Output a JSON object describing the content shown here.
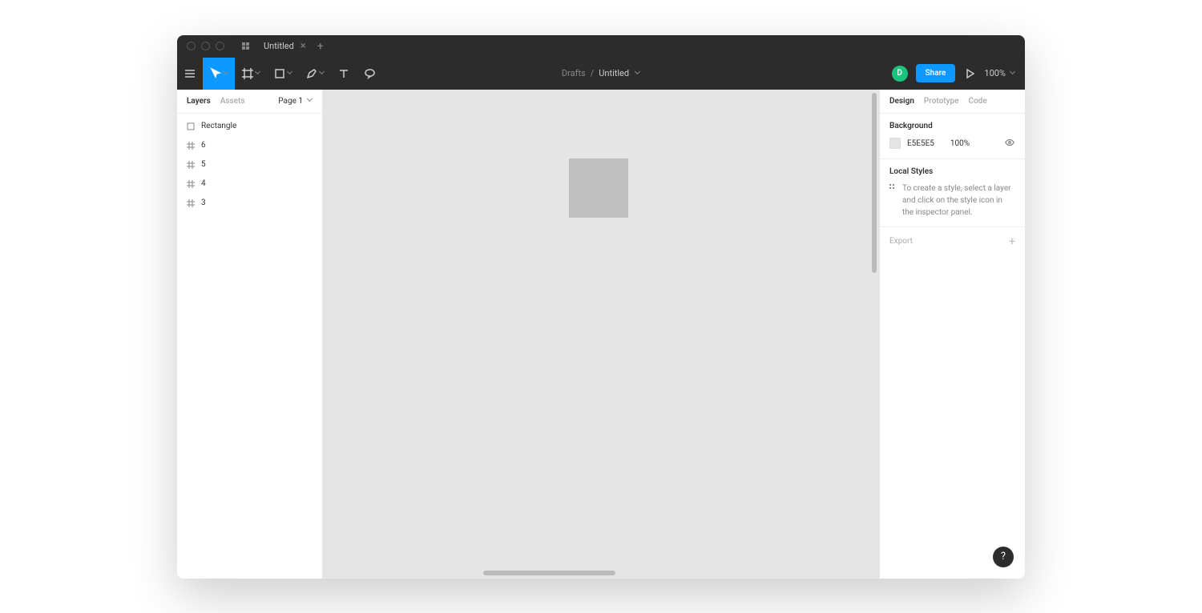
{
  "titlebar": {
    "tab_title": "Untitled"
  },
  "breadcrumb": {
    "folder": "Drafts",
    "file": "Untitled"
  },
  "toolbar": {
    "avatar_letter": "D",
    "share_label": "Share",
    "zoom": "100%"
  },
  "left_panel": {
    "tabs": {
      "layers": "Layers",
      "assets": "Assets"
    },
    "page_label": "Page 1",
    "layers": [
      {
        "type": "rect",
        "name": "Rectangle"
      },
      {
        "type": "frame",
        "name": "6"
      },
      {
        "type": "frame",
        "name": "5"
      },
      {
        "type": "frame",
        "name": "4"
      },
      {
        "type": "frame",
        "name": "3"
      }
    ]
  },
  "right_panel": {
    "tabs": {
      "design": "Design",
      "prototype": "Prototype",
      "code": "Code"
    },
    "background": {
      "heading": "Background",
      "hex": "E5E5E5",
      "opacity": "100%"
    },
    "local_styles": {
      "heading": "Local Styles",
      "hint": "To create a style, select a layer and click on the style icon in the inspector panel."
    },
    "export_label": "Export"
  },
  "help": "?"
}
